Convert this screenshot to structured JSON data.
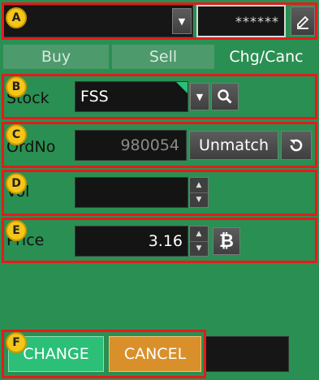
{
  "header": {
    "password_mask": "******"
  },
  "tabs": [
    {
      "label": "Buy"
    },
    {
      "label": "Sell"
    },
    {
      "label": "Chg/Canc"
    }
  ],
  "form": {
    "stock_label": "Stock",
    "stock_value": "FSS",
    "ordno_label": "OrdNo",
    "ordno_value": "980054",
    "unmatch_label": "Unmatch",
    "vol_label": "Vol",
    "vol_value": "",
    "price_label": "Price",
    "price_value": "3.16"
  },
  "actions": {
    "change_label": "CHANGE",
    "cancel_label": "CANCEL"
  },
  "badges": [
    "A",
    "B",
    "C",
    "D",
    "E",
    "F"
  ],
  "colors": {
    "background": "#2a8f52",
    "change_button": "#2bbf77",
    "cancel_button": "#d9902b",
    "highlight": "#e31b1b",
    "badge": "#f5c518"
  }
}
